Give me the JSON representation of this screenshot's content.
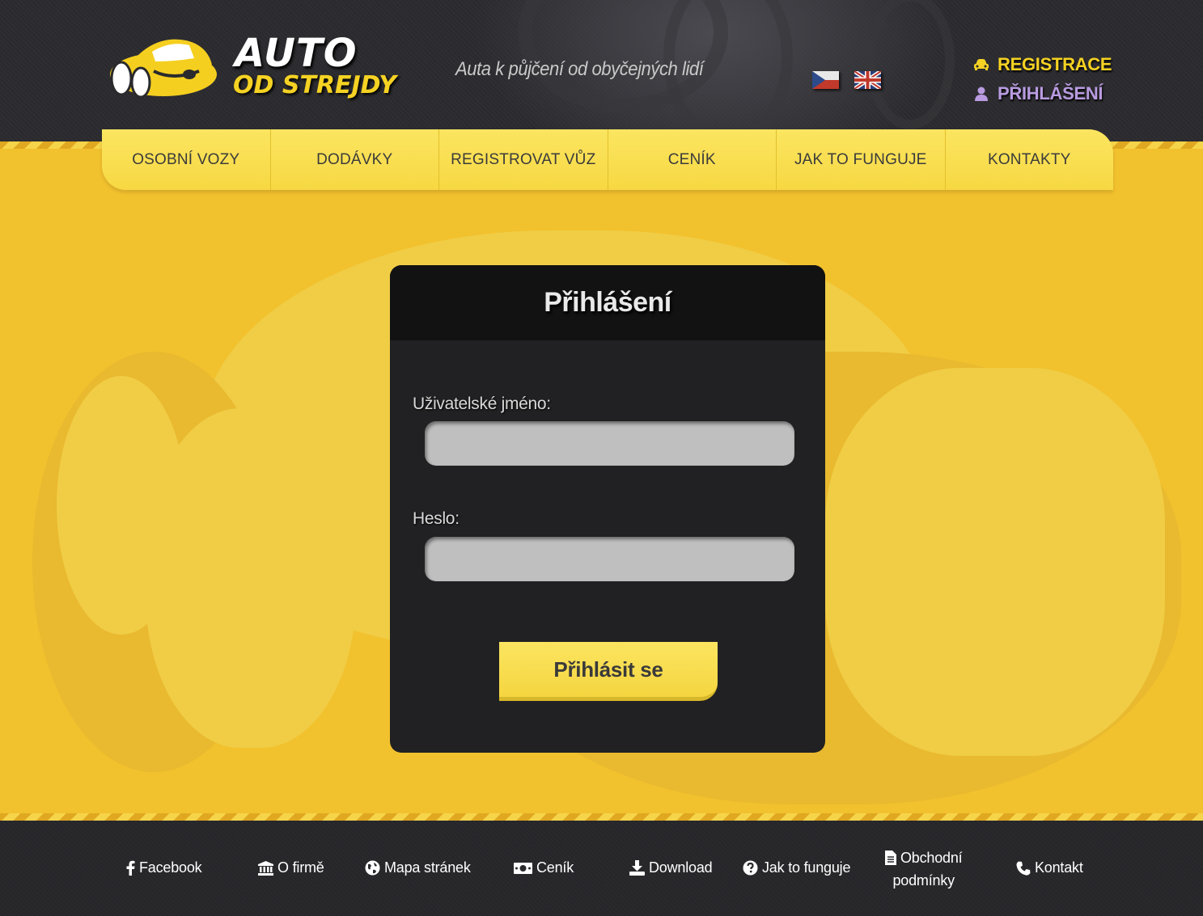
{
  "header": {
    "logo_line1": "AUTO",
    "logo_line2": "OD STREJDY",
    "tagline": "Auta k půjčení od obyčejných lidí",
    "languages": [
      "cz-flag",
      "en-flag"
    ],
    "register_label": "REGISTRACE",
    "login_label": "PŘIHLÁŠENÍ"
  },
  "nav": {
    "items": [
      "OSOBNÍ VOZY",
      "DODÁVKY",
      "REGISTROVAT VŮZ",
      "CENÍK",
      "JAK TO FUNGUJE",
      "KONTAKTY"
    ]
  },
  "login": {
    "title": "Přihlášení",
    "username_label": "Uživatelské jméno:",
    "username_value": "",
    "password_label": "Heslo:",
    "password_value": "",
    "submit_label": "Přihlásit se"
  },
  "footer": {
    "facebook": "Facebook",
    "about": "O firmě",
    "sitemap": "Mapa stránek",
    "pricing": "Ceník",
    "download": "Download",
    "howto": "Jak to funguje",
    "terms_line1": "Obchodní",
    "terms_line2": "podmínky",
    "contact": "Kontakt"
  },
  "colors": {
    "brand_yellow": "#f5d223",
    "page_yellow": "#f2c12e",
    "dark": "#212123",
    "login_link": "#b89be0"
  },
  "icons": {
    "register": "car-icon",
    "login": "user-icon",
    "facebook": "facebook-icon",
    "about": "bank-icon",
    "sitemap": "globe-icon",
    "pricing": "money-icon",
    "download": "download-icon",
    "howto": "question-icon",
    "terms": "document-icon",
    "contact": "phone-icon"
  }
}
